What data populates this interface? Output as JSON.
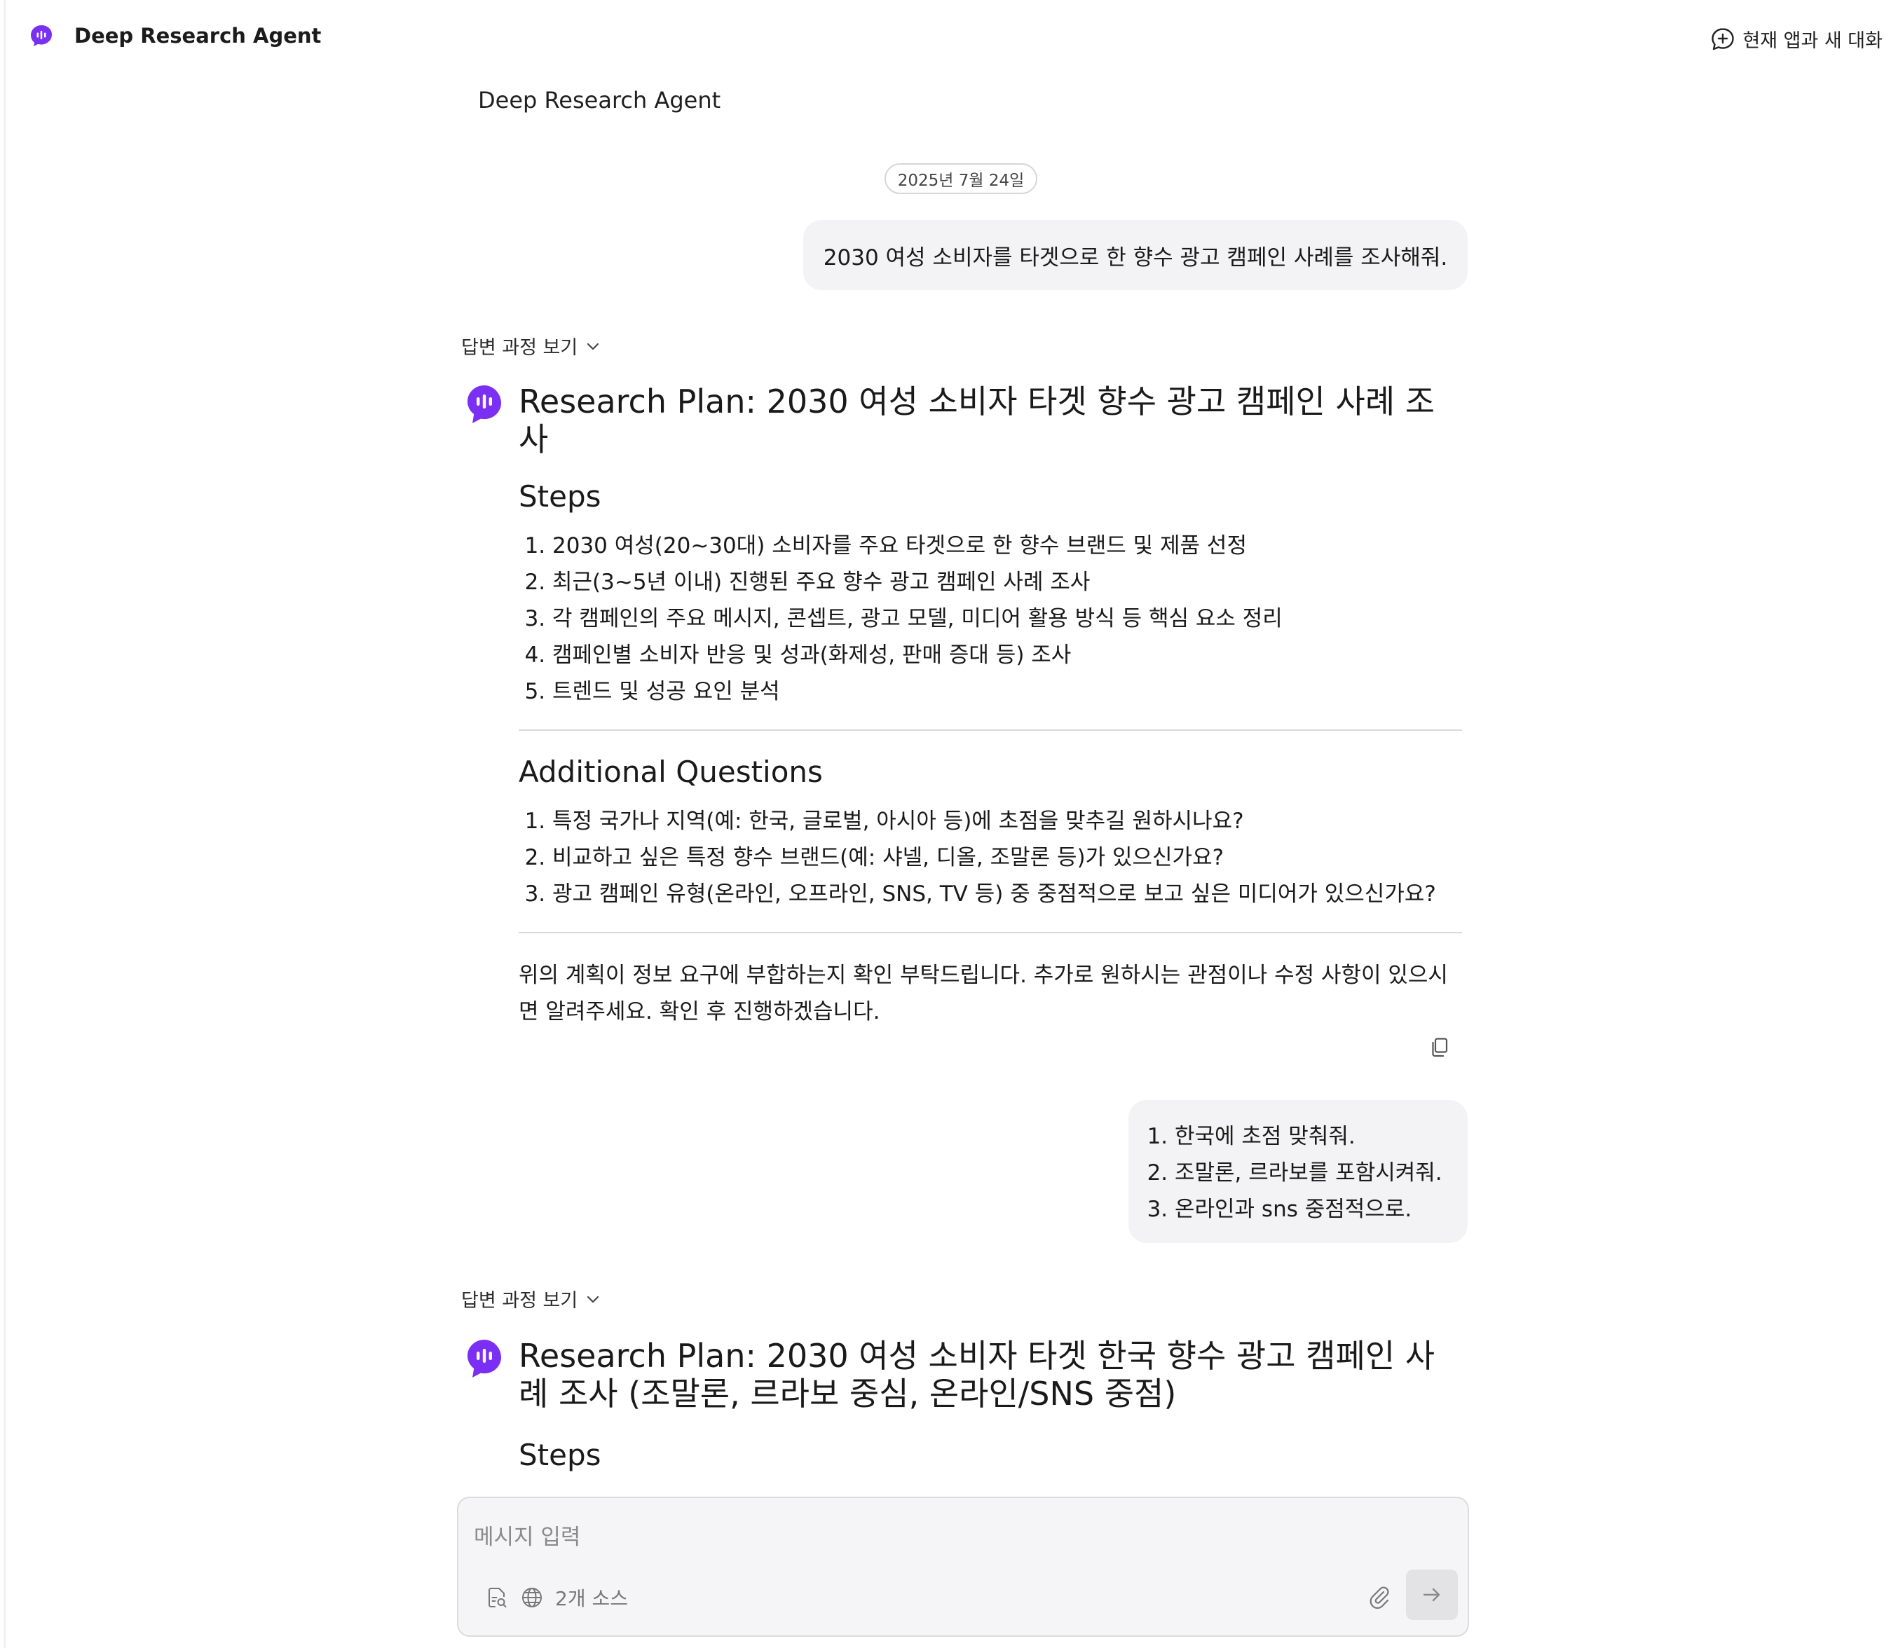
{
  "header": {
    "app_name": "Deep Research Agent",
    "new_chat_label": "현재 앱과 새 대화"
  },
  "conversation": {
    "agent_label": "Deep Research Agent",
    "date": "2025년 7월 24일",
    "user_message_1": "2030 여성 소비자를 타겟으로 한 향수 광고 캠페인 사례를 조사해줘.",
    "process_toggle_label": "답변 과정 보기",
    "answer_1": {
      "title": "Research Plan: 2030 여성 소비자 타겟 향수 광고 캠페인 사례 조사",
      "steps_heading": "Steps",
      "steps": [
        "2030 여성(20~30대) 소비자를 주요 타겟으로 한 향수 브랜드 및 제품 선정",
        "최근(3~5년 이내) 진행된 주요 향수 광고 캠페인 사례 조사",
        "각 캠페인의 주요 메시지, 콘셉트, 광고 모델, 미디어 활용 방식 등 핵심 요소 정리",
        "캠페인별 소비자 반응 및 성과(화제성, 판매 증대 등) 조사",
        "트렌드 및 성공 요인 분석"
      ],
      "questions_heading": "Additional Questions",
      "questions": [
        "특정 국가나 지역(예: 한국, 글로벌, 아시아 등)에 초점을 맞추길 원하시나요?",
        "비교하고 싶은 특정 향수 브랜드(예: 샤넬, 디올, 조말론 등)가 있으신가요?",
        "광고 캠페인 유형(온라인, 오프라인, SNS, TV 등) 중 중점적으로 보고 싶은 미디어가 있으신가요?"
      ],
      "closing": "위의 계획이 정보 요구에 부합하는지 확인 부탁드립니다. 추가로 원하시는 관점이나 수정 사항이 있으시면 알려주세요. 확인 후 진행하겠습니다."
    },
    "user_message_2": [
      "한국에 초점 맞춰줘.",
      "조말론, 르라보를 포함시켜줘.",
      "온라인과 sns 중점적으로."
    ],
    "answer_2": {
      "title": "Research Plan: 2030 여성 소비자 타겟 한국 향수 광고 캠페인 사례 조사 (조말론, 르라보 중심, 온라인/SNS 중점)",
      "steps_heading": "Steps"
    }
  },
  "composer": {
    "placeholder": "메시지 입력",
    "sources_label": "2개 소스"
  },
  "icons": {
    "brand_logo": "chat-bubble-waveform-icon",
    "new_chat": "chat-plus-icon",
    "chevron": "chevron-down-icon",
    "copy": "copy-icon",
    "file_search": "file-search-icon",
    "globe": "globe-icon",
    "attach": "paperclip-icon",
    "send": "arrow-right-icon"
  },
  "colors": {
    "accent": "#7b2ff2",
    "bubble_bg": "#f3f3f5",
    "composer_bg": "#f5f5f7"
  }
}
